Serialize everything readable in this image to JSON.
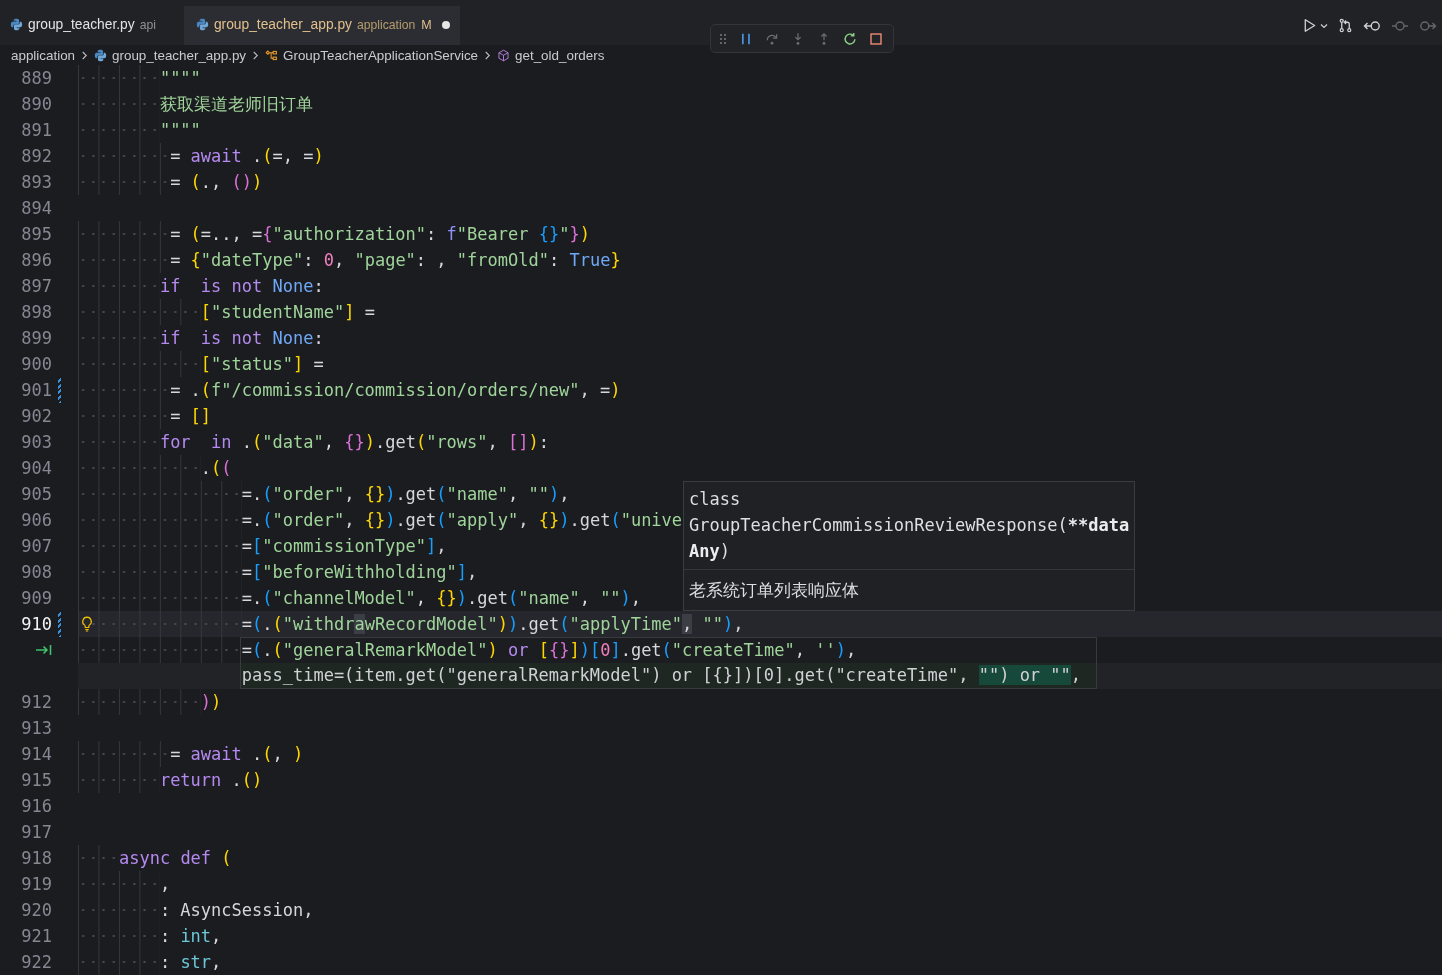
{
  "tabs": [
    {
      "name": "group_teacher.py",
      "description": "api",
      "selected": false,
      "unsaved": false
    },
    {
      "name": "group_teacher_app.py",
      "description": "application",
      "status": "M",
      "selected": true,
      "unsaved": true
    }
  ],
  "debug_toolbar": {
    "buttons": [
      {
        "kind": "pause",
        "disabled": false
      },
      {
        "kind": "step-over",
        "disabled": true
      },
      {
        "kind": "step-into",
        "disabled": true
      },
      {
        "kind": "step-out",
        "disabled": true
      },
      {
        "kind": "restart",
        "disabled": false
      },
      {
        "kind": "stop",
        "disabled": false
      }
    ]
  },
  "editor_actions": [
    {
      "kind": "run",
      "disabled": false
    },
    {
      "kind": "compare",
      "disabled": false
    },
    {
      "kind": "back",
      "disabled": false
    },
    {
      "kind": "center",
      "disabled": true
    },
    {
      "kind": "forward",
      "disabled": true
    }
  ],
  "breadcrumbs": [
    {
      "kind": "folder",
      "label": "application"
    },
    {
      "kind": "file",
      "label": "group_teacher_app.py"
    },
    {
      "kind": "class",
      "label": "GroupTeacherApplicationService"
    },
    {
      "kind": "method",
      "label": "get_old_orders"
    }
  ],
  "editor": {
    "lines": [
      {
        "kind": "code",
        "number": "889",
        "current": false,
        "modified": false,
        "tokens": [
          {
            "text": "        \"\"\"\"",
            "kind": "string"
          }
        ]
      },
      {
        "kind": "code",
        "number": "890",
        "current": false,
        "modified": false,
        "tokens": [
          {
            "text": "        获取渠道老师旧订单",
            "kind": "string"
          }
        ]
      },
      {
        "kind": "code",
        "number": "891",
        "current": false,
        "modified": false,
        "tokens": [
          {
            "text": "        \"\"\"\"",
            "kind": "string"
          }
        ]
      },
      {
        "kind": "code",
        "number": "892",
        "current": false,
        "modified": false,
        "tokens": [
          {
            "text": "         = ",
            "kind": "plain"
          },
          {
            "text": "await",
            "kind": "keyword"
          },
          {
            "text": " .",
            "kind": "plain"
          },
          {
            "text": "(",
            "kind": "bracket1"
          },
          {
            "text": "=, =",
            "kind": "plain"
          },
          {
            "text": ")",
            "kind": "bracket1"
          }
        ]
      },
      {
        "kind": "code",
        "number": "893",
        "current": false,
        "modified": false,
        "tokens": [
          {
            "text": "         = ",
            "kind": "plain"
          },
          {
            "text": "(",
            "kind": "bracket1"
          },
          {
            "text": "., ",
            "kind": "plain"
          },
          {
            "text": "()",
            "kind": "bracket2"
          },
          {
            "text": ")",
            "kind": "bracket1"
          }
        ]
      },
      {
        "kind": "code",
        "number": "894",
        "current": false,
        "modified": false
      },
      {
        "kind": "code",
        "number": "895",
        "current": false,
        "modified": false,
        "tokens": [
          {
            "text": "         = ",
            "kind": "plain"
          },
          {
            "text": "(",
            "kind": "bracket1"
          },
          {
            "text": "=.., =",
            "kind": "plain"
          },
          {
            "text": "{",
            "kind": "bracket2"
          },
          {
            "text": "\"authorization\"",
            "kind": "string"
          },
          {
            "text": ": ",
            "kind": "plain"
          },
          {
            "text": "f",
            "kind": "fprefix"
          },
          {
            "text": "\"Bearer ",
            "kind": "string"
          },
          {
            "text": "{}",
            "kind": "bracket3"
          },
          {
            "text": "\"",
            "kind": "string"
          },
          {
            "text": "}",
            "kind": "bracket2"
          },
          {
            "text": ")",
            "kind": "bracket1"
          }
        ]
      },
      {
        "kind": "code",
        "number": "896",
        "current": false,
        "modified": false,
        "tokens": [
          {
            "text": "         = ",
            "kind": "plain"
          },
          {
            "text": "{",
            "kind": "bracket1"
          },
          {
            "text": "\"dateType\"",
            "kind": "string"
          },
          {
            "text": ": ",
            "kind": "plain"
          },
          {
            "text": "0",
            "kind": "number"
          },
          {
            "text": ", ",
            "kind": "plain"
          },
          {
            "text": "\"page\"",
            "kind": "string"
          },
          {
            "text": ": , ",
            "kind": "plain"
          },
          {
            "text": "\"fromOld\"",
            "kind": "string"
          },
          {
            "text": ": ",
            "kind": "plain"
          },
          {
            "text": "True",
            "kind": "constant"
          },
          {
            "text": "}",
            "kind": "bracket1"
          }
        ]
      },
      {
        "kind": "code",
        "number": "897",
        "current": false,
        "modified": false,
        "tokens": [
          {
            "text": "        if",
            "kind": "keyword"
          },
          {
            "text": "  is not",
            "kind": "keyword"
          },
          {
            "text": " None",
            "kind": "constant"
          },
          {
            "text": ":",
            "kind": "plain"
          }
        ]
      },
      {
        "kind": "code",
        "number": "898",
        "current": false,
        "modified": false,
        "tokens": [
          {
            "text": "            [",
            "kind": "bracket1"
          },
          {
            "text": "\"studentName\"",
            "kind": "string"
          },
          {
            "text": "]",
            "kind": "bracket1"
          },
          {
            "text": " =",
            "kind": "plain"
          }
        ]
      },
      {
        "kind": "code",
        "number": "899",
        "current": false,
        "modified": false,
        "tokens": [
          {
            "text": "        if",
            "kind": "keyword"
          },
          {
            "text": "  is not",
            "kind": "keyword"
          },
          {
            "text": " None",
            "kind": "constant"
          },
          {
            "text": ":",
            "kind": "plain"
          }
        ]
      },
      {
        "kind": "code",
        "number": "900",
        "current": false,
        "modified": false,
        "tokens": [
          {
            "text": "            [",
            "kind": "bracket1"
          },
          {
            "text": "\"status\"",
            "kind": "string"
          },
          {
            "text": "]",
            "kind": "bracket1"
          },
          {
            "text": " =",
            "kind": "plain"
          }
        ]
      },
      {
        "kind": "code",
        "number": "901",
        "current": false,
        "modified": true,
        "tokens": [
          {
            "text": "         = .",
            "kind": "plain"
          },
          {
            "text": "(",
            "kind": "bracket1"
          },
          {
            "text": "f\"/commission/commission/orders/new\"",
            "kind": "string"
          },
          {
            "text": ", =",
            "kind": "plain"
          },
          {
            "text": ")",
            "kind": "bracket1"
          }
        ]
      },
      {
        "kind": "code",
        "number": "902",
        "current": false,
        "modified": false,
        "tokens": [
          {
            "text": "         = ",
            "kind": "plain"
          },
          {
            "text": "[]",
            "kind": "bracket1"
          }
        ]
      },
      {
        "kind": "code",
        "number": "903",
        "current": false,
        "modified": false,
        "tokens": [
          {
            "text": "        for",
            "kind": "keyword"
          },
          {
            "text": "  in",
            "kind": "keyword"
          },
          {
            "text": " .",
            "kind": "plain"
          },
          {
            "text": "(",
            "kind": "bracket1"
          },
          {
            "text": "\"data\"",
            "kind": "string"
          },
          {
            "text": ", ",
            "kind": "plain"
          },
          {
            "text": "{}",
            "kind": "bracket2"
          },
          {
            "text": ")",
            "kind": "bracket1"
          },
          {
            "text": ".get",
            "kind": "plain"
          },
          {
            "text": "(",
            "kind": "bracket1"
          },
          {
            "text": "\"rows\"",
            "kind": "string"
          },
          {
            "text": ", ",
            "kind": "plain"
          },
          {
            "text": "[]",
            "kind": "bracket2"
          },
          {
            "text": ")",
            "kind": "bracket1"
          },
          {
            "text": ":",
            "kind": "plain"
          }
        ]
      },
      {
        "kind": "code",
        "number": "904",
        "current": false,
        "modified": false,
        "tokens": [
          {
            "text": "            .",
            "kind": "plain"
          },
          {
            "text": "(",
            "kind": "bracket1"
          },
          {
            "text": "(",
            "kind": "bracket2"
          }
        ]
      },
      {
        "kind": "code",
        "number": "905",
        "current": false,
        "modified": false,
        "tokens": [
          {
            "text": "                =.",
            "kind": "plain"
          },
          {
            "text": "(",
            "kind": "bracket3"
          },
          {
            "text": "\"order\"",
            "kind": "string"
          },
          {
            "text": ", ",
            "kind": "plain"
          },
          {
            "text": "{}",
            "kind": "bracket1"
          },
          {
            "text": ")",
            "kind": "bracket3"
          },
          {
            "text": ".get",
            "kind": "plain"
          },
          {
            "text": "(",
            "kind": "bracket3"
          },
          {
            "text": "\"name\"",
            "kind": "string"
          },
          {
            "text": ", ",
            "kind": "plain"
          },
          {
            "text": "\"\"",
            "kind": "string"
          },
          {
            "text": ")",
            "kind": "bracket3"
          },
          {
            "text": ",",
            "kind": "plain"
          }
        ]
      },
      {
        "kind": "code",
        "number": "906",
        "current": false,
        "modified": false,
        "tokens": [
          {
            "text": "                =.",
            "kind": "plain"
          },
          {
            "text": "(",
            "kind": "bracket3"
          },
          {
            "text": "\"order\"",
            "kind": "string"
          },
          {
            "text": ", ",
            "kind": "plain"
          },
          {
            "text": "{}",
            "kind": "bracket1"
          },
          {
            "text": ")",
            "kind": "bracket3"
          },
          {
            "text": ".get",
            "kind": "plain"
          },
          {
            "text": "(",
            "kind": "bracket3"
          },
          {
            "text": "\"apply\"",
            "kind": "string"
          },
          {
            "text": ", ",
            "kind": "plain"
          },
          {
            "text": "{}",
            "kind": "bracket1"
          },
          {
            "text": ")",
            "kind": "bracket3"
          },
          {
            "text": ".get",
            "kind": "plain"
          },
          {
            "text": "(",
            "kind": "bracket3"
          },
          {
            "text": "\"unive",
            "kind": "string"
          }
        ]
      },
      {
        "kind": "code",
        "number": "907",
        "current": false,
        "modified": false,
        "tokens": [
          {
            "text": "                =",
            "kind": "plain"
          },
          {
            "text": "[",
            "kind": "bracket3"
          },
          {
            "text": "\"commissionType\"",
            "kind": "string"
          },
          {
            "text": "]",
            "kind": "bracket3"
          },
          {
            "text": ",",
            "kind": "plain"
          }
        ]
      },
      {
        "kind": "code",
        "number": "908",
        "current": false,
        "modified": false,
        "tokens": [
          {
            "text": "                =",
            "kind": "plain"
          },
          {
            "text": "[",
            "kind": "bracket3"
          },
          {
            "text": "\"beforeWithholding\"",
            "kind": "string"
          },
          {
            "text": "]",
            "kind": "bracket3"
          },
          {
            "text": ",",
            "kind": "plain"
          }
        ]
      },
      {
        "kind": "code",
        "number": "909",
        "current": false,
        "modified": false,
        "tokens": [
          {
            "text": "                =.",
            "kind": "plain"
          },
          {
            "text": "(",
            "kind": "bracket3"
          },
          {
            "text": "\"channelModel\"",
            "kind": "string"
          },
          {
            "text": ", ",
            "kind": "plain"
          },
          {
            "text": "{}",
            "kind": "bracket1"
          },
          {
            "text": ")",
            "kind": "bracket3"
          },
          {
            "text": ".get",
            "kind": "plain"
          },
          {
            "text": "(",
            "kind": "bracket3"
          },
          {
            "text": "\"name\"",
            "kind": "string"
          },
          {
            "text": ", ",
            "kind": "plain"
          },
          {
            "text": "\"\"",
            "kind": "string"
          },
          {
            "text": ")",
            "kind": "bracket3"
          },
          {
            "text": ",",
            "kind": "plain"
          }
        ]
      },
      {
        "kind": "code",
        "number": "910",
        "current": true,
        "modified": true,
        "tokens": [
          {
            "text": "                =",
            "kind": "plain"
          },
          {
            "text": "(",
            "kind": "bracket3"
          },
          {
            "text": ".",
            "kind": "plain"
          },
          {
            "text": "(",
            "kind": "bracket1"
          },
          {
            "text": "\"withdr",
            "kind": "string"
          },
          {
            "text": "a",
            "kind": "string-match"
          },
          {
            "text": "wRecordModel\"",
            "kind": "string"
          },
          {
            "text": ")",
            "kind": "bracket1"
          },
          {
            "text": ")",
            "kind": "bracket3"
          },
          {
            "text": ".get",
            "kind": "plain"
          },
          {
            "text": "(",
            "kind": "bracket3"
          },
          {
            "text": "\"applyTime\"",
            "kind": "string"
          },
          {
            "text": ",",
            "kind": "match"
          },
          {
            "text": " \"\"",
            "kind": "string"
          },
          {
            "text": ")",
            "kind": "bracket3"
          },
          {
            "text": ",",
            "kind": "plain"
          }
        ]
      },
      {
        "kind": "suggestion",
        "current": false,
        "modified": false,
        "tokens": [
          {
            "text": "                =",
            "kind": "plain"
          },
          {
            "text": "(",
            "kind": "bracket3"
          },
          {
            "text": ".",
            "kind": "plain"
          },
          {
            "text": "(",
            "kind": "bracket1"
          },
          {
            "text": "\"generalRemarkModel\"",
            "kind": "string"
          },
          {
            "text": ")",
            "kind": "bracket1"
          },
          {
            "text": " or ",
            "kind": "keyword"
          },
          {
            "text": "[",
            "kind": "bracket1"
          },
          {
            "text": "{}",
            "kind": "bracket2"
          },
          {
            "text": "]",
            "kind": "bracket1"
          },
          {
            "text": ")",
            "kind": "bracket3"
          },
          {
            "text": "[",
            "kind": "bracket3"
          },
          {
            "text": "0",
            "kind": "number"
          },
          {
            "text": "]",
            "kind": "bracket3"
          },
          {
            "text": ".get",
            "kind": "plain"
          },
          {
            "text": "(",
            "kind": "bracket3"
          },
          {
            "text": "\"createTime\"",
            "kind": "string"
          },
          {
            "text": ", ",
            "kind": "plain"
          },
          {
            "text": "''",
            "kind": "string"
          },
          {
            "text": ")",
            "kind": "bracket3"
          },
          {
            "text": ",",
            "kind": "plain"
          }
        ]
      },
      {
        "kind": "ghost",
        "current": false,
        "modified": false,
        "tokens": [
          {
            "text": "                pass_time=(item.get(\"generalRemarkModel\") or [{}])[0].get(\"createTime\", ",
            "kind": "ghost"
          },
          {
            "text": "\"\") or \"\"",
            "kind": "ghost-added"
          },
          {
            "text": ",",
            "kind": "ghost"
          }
        ]
      },
      {
        "kind": "code",
        "number": "912",
        "current": false,
        "modified": false,
        "tokens": [
          {
            "text": "            )",
            "kind": "bracket2"
          },
          {
            "text": ")",
            "kind": "bracket1"
          }
        ]
      },
      {
        "kind": "code",
        "number": "913",
        "current": false,
        "modified": false
      },
      {
        "kind": "code",
        "number": "914",
        "current": false,
        "modified": false,
        "tokens": [
          {
            "text": "         = ",
            "kind": "plain"
          },
          {
            "text": "await",
            "kind": "keyword"
          },
          {
            "text": " .",
            "kind": "plain"
          },
          {
            "text": "(",
            "kind": "bracket1"
          },
          {
            "text": ", ",
            "kind": "plain"
          },
          {
            "text": ")",
            "kind": "bracket1"
          }
        ]
      },
      {
        "kind": "code",
        "number": "915",
        "current": false,
        "modified": false,
        "tokens": [
          {
            "text": "        return",
            "kind": "keyword"
          },
          {
            "text": " .",
            "kind": "plain"
          },
          {
            "text": "()",
            "kind": "bracket1"
          }
        ]
      },
      {
        "kind": "code",
        "number": "916",
        "current": false,
        "modified": false
      },
      {
        "kind": "code",
        "number": "917",
        "current": false,
        "modified": false
      },
      {
        "kind": "code",
        "number": "918",
        "current": false,
        "modified": false,
        "tokens": [
          {
            "text": "    async",
            "kind": "keyword"
          },
          {
            "text": " def",
            "kind": "keyword"
          },
          {
            "text": " (",
            "kind": "bracket1"
          }
        ]
      },
      {
        "kind": "code",
        "number": "919",
        "current": false,
        "modified": false,
        "tokens": [
          {
            "text": "        ,",
            "kind": "plain"
          }
        ]
      },
      {
        "kind": "code",
        "number": "920",
        "current": false,
        "modified": false,
        "tokens": [
          {
            "text": "        : AsyncSession,",
            "kind": "plain"
          }
        ]
      },
      {
        "kind": "code",
        "number": "921",
        "current": false,
        "modified": false,
        "tokens": [
          {
            "text": "        : ",
            "kind": "plain"
          },
          {
            "text": "int",
            "kind": "type"
          },
          {
            "text": ",",
            "kind": "plain"
          }
        ]
      },
      {
        "kind": "code",
        "number": "922",
        "current": false,
        "modified": false,
        "tokens": [
          {
            "text": "        : ",
            "kind": "plain"
          },
          {
            "text": "str",
            "kind": "type"
          },
          {
            "text": ",",
            "kind": "plain"
          }
        ]
      }
    ]
  },
  "hover": {
    "signature": [
      {
        "tokens": [
          {
            "text": "class",
            "bold": false
          }
        ]
      },
      {
        "tokens": [
          {
            "text": "GroupTeacherCommissionReviewResponse(",
            "bold": false
          },
          {
            "text": "**data",
            "bold": true
          }
        ]
      },
      {
        "tokens": [
          {
            "text": "Any",
            "bold": true
          },
          {
            "text": ")",
            "bold": false
          }
        ]
      }
    ],
    "doc": "老系统订单列表响应体"
  }
}
